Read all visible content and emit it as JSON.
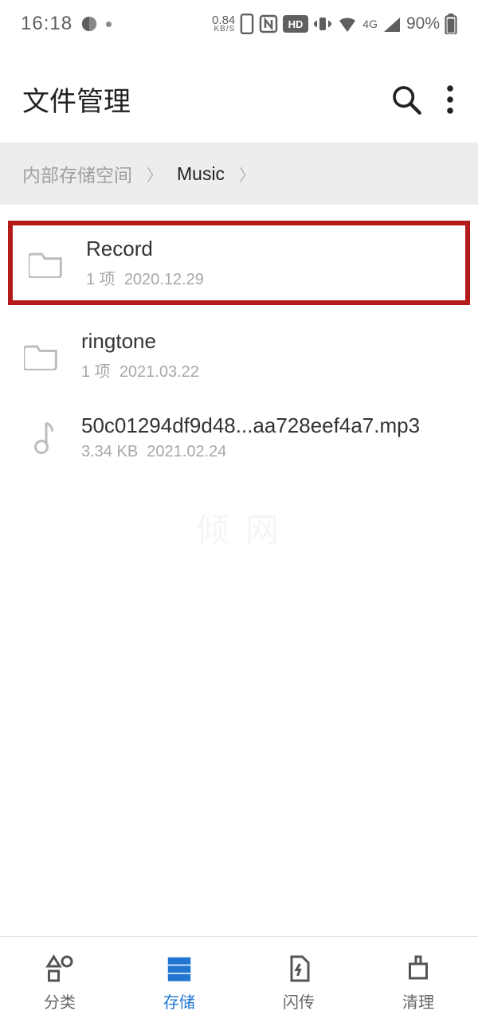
{
  "status": {
    "time": "16:18",
    "kbs_value": "0.84",
    "kbs_unit": "KB/S",
    "net": "4G",
    "battery": "90%"
  },
  "header": {
    "title": "文件管理"
  },
  "breadcrumb": {
    "root": "内部存储空间",
    "current": "Music"
  },
  "items": [
    {
      "name": "Record",
      "count": "1 项",
      "date": "2020.12.29",
      "type": "folder",
      "highlight": true
    },
    {
      "name": "ringtone",
      "count": "1 项",
      "date": "2021.03.22",
      "type": "folder",
      "highlight": false
    },
    {
      "name": "50c01294df9d48...aa728eef4a7.mp3",
      "size": "3.34 KB",
      "date": "2021.02.24",
      "type": "music",
      "highlight": false
    }
  ],
  "nav": {
    "cat": "分类",
    "storage": "存储",
    "flash": "闪传",
    "clean": "清理",
    "active": "storage"
  },
  "watermark": "倾 网"
}
